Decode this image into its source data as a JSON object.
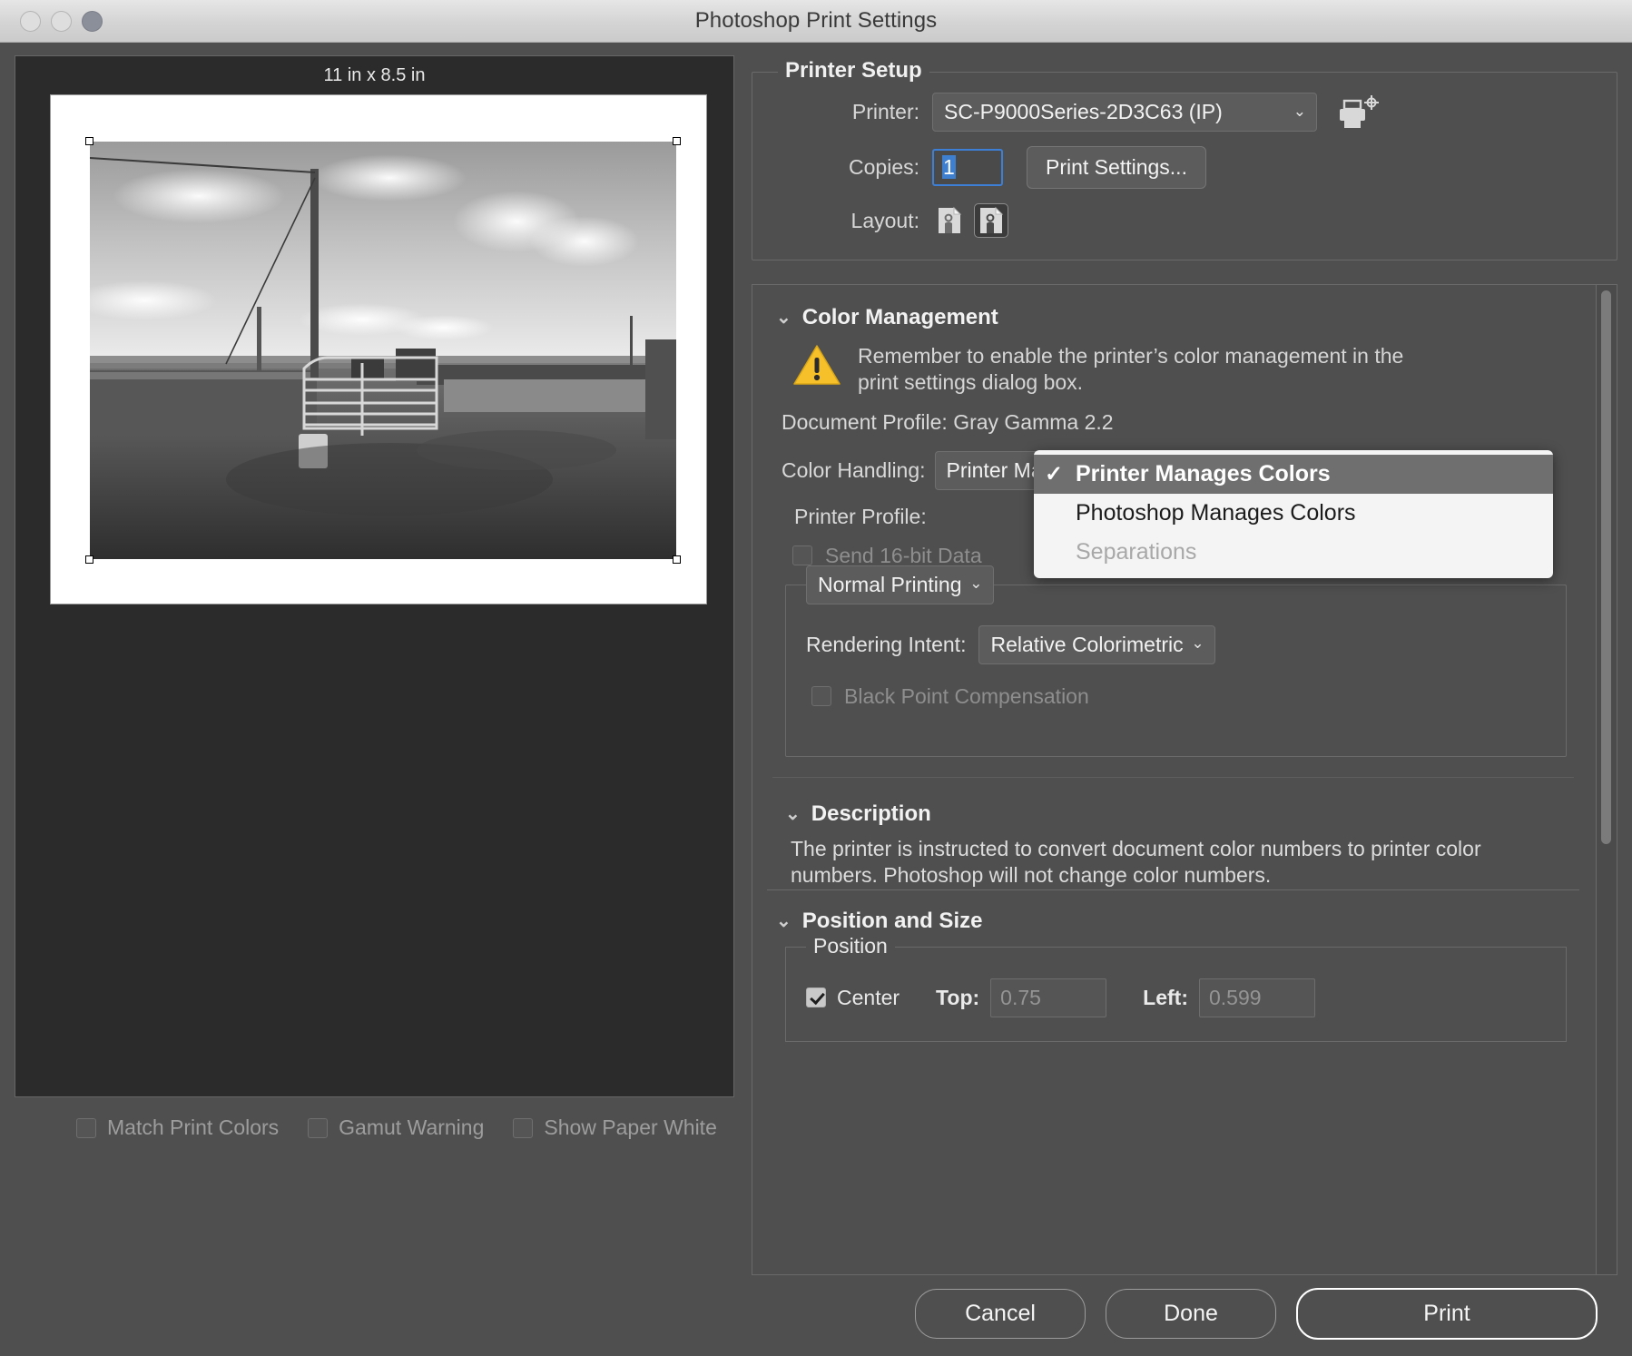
{
  "window": {
    "title": "Photoshop Print Settings",
    "traffic_lights": [
      "close",
      "minimize",
      "zoom"
    ]
  },
  "preview": {
    "dimensions_label": "11 in x 8.5 in",
    "image_description": "Black and white photograph of a rural farmyard gate with stone wall, utility pole and gravel driveway"
  },
  "bottom_options": [
    {
      "label": "Match Print Colors",
      "checked": false,
      "enabled": false
    },
    {
      "label": "Gamut Warning",
      "checked": false,
      "enabled": false
    },
    {
      "label": "Show Paper White",
      "checked": false,
      "enabled": false
    }
  ],
  "printer_setup": {
    "title": "Printer Setup",
    "printer_label": "Printer:",
    "printer_value": "SC-P9000Series-2D3C63 (IP)",
    "copies_label": "Copies:",
    "copies_value": "1",
    "print_settings_button": "Print Settings...",
    "layout_label": "Layout:",
    "layout_options": [
      "portrait",
      "landscape"
    ],
    "layout_selected": "landscape",
    "printer_icon": "printer-with-registration-target"
  },
  "color_management": {
    "title": "Color Management",
    "expanded": true,
    "warning_icon": "warning-triangle-icon",
    "warning_text": "Remember to enable the printer’s color management in the print settings dialog box.",
    "document_profile": "Document Profile: Gray Gamma 2.2",
    "color_handling_label": "Color Handling:",
    "color_handling_value": "Printer Manages Colors",
    "printer_profile_label": "Printer Profile:",
    "send_16bit_label": "Send 16-bit Data",
    "send_16bit_checked": false,
    "send_16bit_enabled": false,
    "print_mode_value": "Normal Printing",
    "rendering_intent_label": "Rendering Intent:",
    "rendering_intent_value": "Relative Colorimetric",
    "black_point_label": "Black Point Compensation",
    "black_point_checked": false,
    "black_point_enabled": false
  },
  "color_handling_menu": {
    "open": true,
    "items": [
      {
        "label": "Printer Manages Colors",
        "checked": true,
        "enabled": true,
        "highlighted": true
      },
      {
        "label": "Photoshop Manages Colors",
        "checked": false,
        "enabled": true,
        "highlighted": false
      },
      {
        "label": "Separations",
        "checked": false,
        "enabled": false,
        "highlighted": false
      }
    ]
  },
  "description": {
    "title": "Description",
    "expanded": true,
    "text": "The printer is instructed to convert document color numbers to printer color numbers. Photoshop will not change color numbers."
  },
  "position_and_size": {
    "title": "Position and Size",
    "expanded": true,
    "position_legend": "Position",
    "center_label": "Center",
    "center_checked": true,
    "top_label": "Top:",
    "top_value": "0.75",
    "left_label": "Left:",
    "left_value": "0.599"
  },
  "footer_buttons": {
    "cancel": "Cancel",
    "done": "Done",
    "print": "Print"
  },
  "colors": {
    "dialog_bg": "#4f4f4f",
    "panel_bg": "#4f4f4f",
    "preview_bg": "#2b2b2b",
    "accent_focus": "#3d7fd6",
    "warning_yellow": "#f5c02a",
    "menu_bg": "#f4f4f4",
    "menu_highlight": "#6f6f6f"
  }
}
